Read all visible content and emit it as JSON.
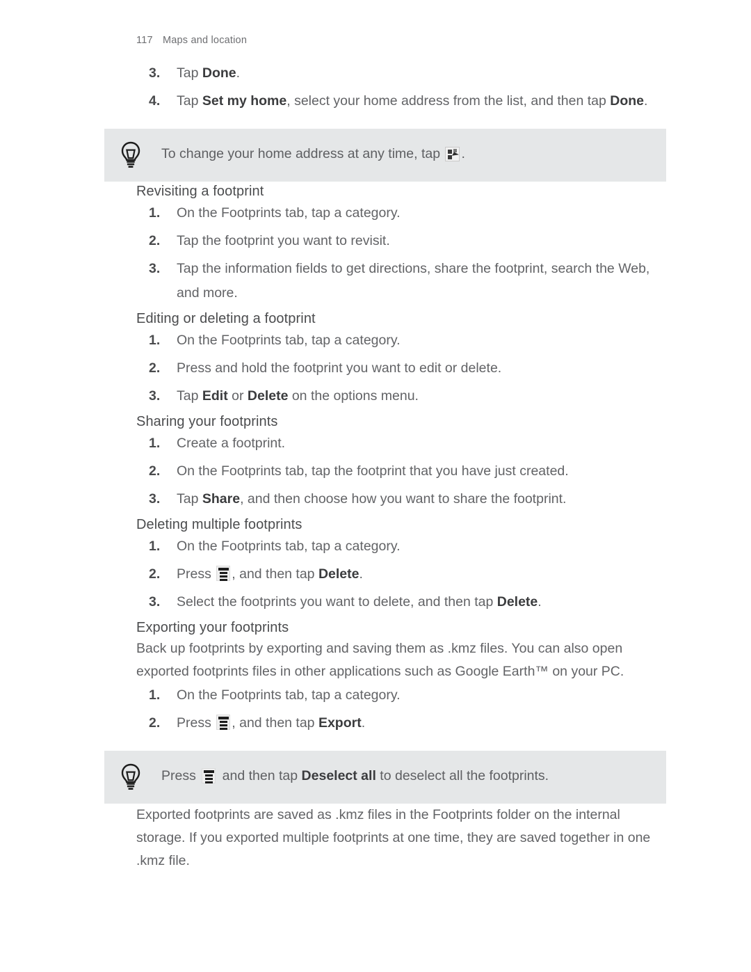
{
  "header": {
    "page_number": "117",
    "title": "Maps and location"
  },
  "icons": {
    "bulb": "lightbulb-icon",
    "menu": "menu-icon",
    "grid_cursor": "grid-cursor-icon"
  },
  "colors": {
    "tip_background": "#e5e7e8",
    "body_text": "#626366",
    "heading_text": "#4b4c4e",
    "bold_text": "#3b3c3e"
  },
  "top_steps": [
    {
      "num": "3.",
      "pre": "Tap ",
      "bold": "Done",
      "post": "."
    },
    {
      "num": "4.",
      "pre": "Tap ",
      "bold": "Set my home",
      "post": ", select your home address from the list, and then tap ",
      "bold2": "Done",
      "post2": "."
    }
  ],
  "tip_home": {
    "pre": "To change your home address at any time, tap ",
    "post": "."
  },
  "sections": [
    {
      "heading": "Revisiting a footprint",
      "steps": [
        {
          "num": "1.",
          "text": "On the Footprints tab, tap a category."
        },
        {
          "num": "2.",
          "text": "Tap the footprint you want to revisit."
        },
        {
          "num": "3.",
          "text": "Tap the information fields to get directions, share the footprint, search the Web, and more."
        }
      ]
    },
    {
      "heading": "Editing or deleting a footprint",
      "steps": [
        {
          "num": "1.",
          "text": "On the Footprints tab, tap a category."
        },
        {
          "num": "2.",
          "text": "Press and hold the footprint you want to edit or delete."
        },
        {
          "num": "3.",
          "pre": "Tap ",
          "bold": "Edit",
          "mid": " or ",
          "bold2": "Delete",
          "post": " on the options menu."
        }
      ]
    },
    {
      "heading": "Sharing your footprints",
      "steps": [
        {
          "num": "1.",
          "text": "Create a footprint."
        },
        {
          "num": "2.",
          "text": "On the Footprints tab, tap the footprint that you have just created."
        },
        {
          "num": "3.",
          "pre": "Tap ",
          "bold": "Share",
          "post": ", and then choose how you want to share the footprint."
        }
      ]
    },
    {
      "heading": "Deleting multiple footprints",
      "steps": [
        {
          "num": "1.",
          "text": "On the Footprints tab, tap a category."
        },
        {
          "num": "2.",
          "pre": "Press ",
          "post": ", and then tap ",
          "bold": "Delete",
          "tail": "."
        },
        {
          "num": "3.",
          "pre": "Select the footprints you want to delete, and then tap ",
          "bold": "Delete",
          "post": "."
        }
      ]
    },
    {
      "heading": "Exporting your footprints",
      "intro": "Back up footprints by exporting and saving them as .kmz files. You can also open exported footprints files in other applications such as Google Earth™ on your PC.",
      "steps": [
        {
          "num": "1.",
          "text": "On the Footprints tab, tap a category."
        },
        {
          "num": "2.",
          "pre": "Press ",
          "post": ", and then tap ",
          "bold": "Export",
          "tail": "."
        }
      ]
    }
  ],
  "tip_deselect": {
    "pre": "Press ",
    "mid": " and then tap ",
    "bold": "Deselect all",
    "post": " to deselect all the footprints."
  },
  "closing_paragraph": "Exported footprints are saved as .kmz files in the Footprints folder on the internal storage. If you exported multiple footprints at one time, they are saved together in one .kmz file."
}
